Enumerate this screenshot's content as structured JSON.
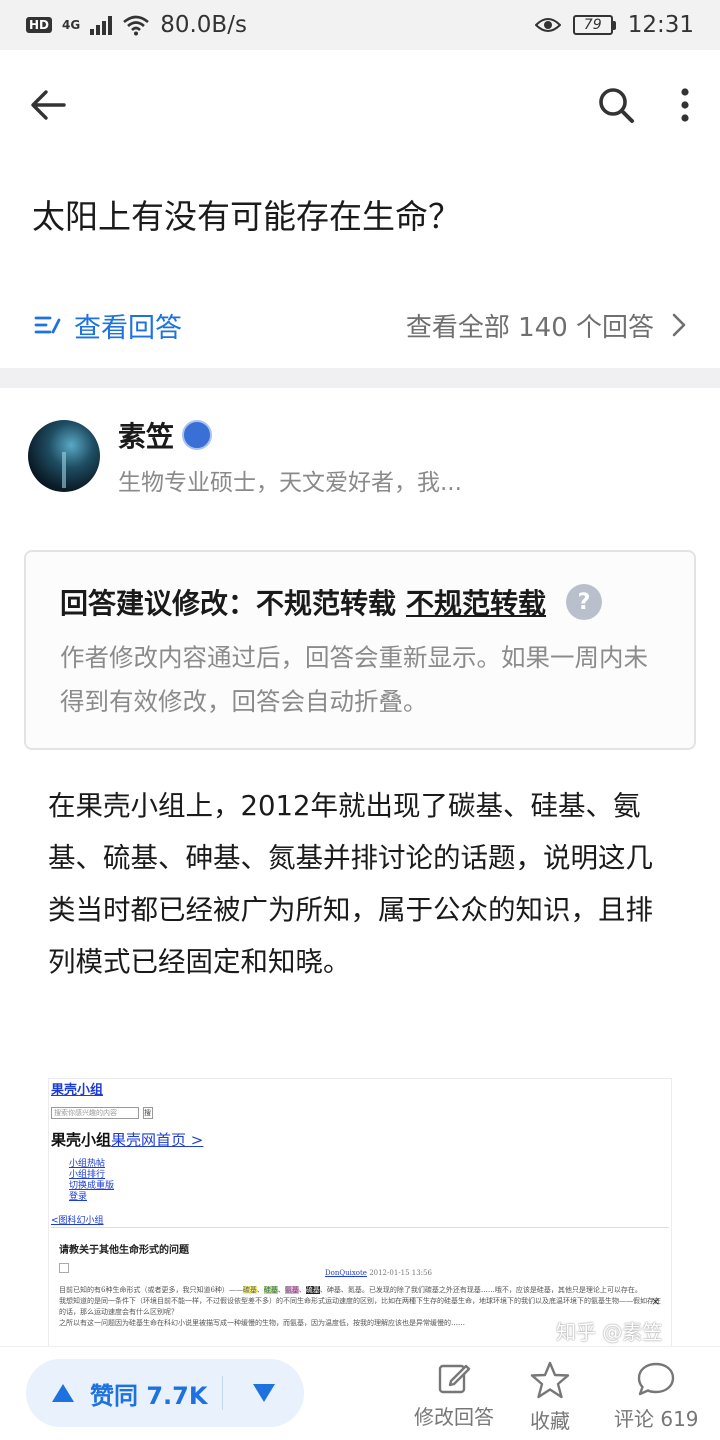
{
  "status_bar": {
    "hd": "HD",
    "network": "4G",
    "speed": "80.0B/s",
    "battery": "79",
    "time": "12:31"
  },
  "top_bar": {
    "back_icon": "arrow-left-icon",
    "search_icon": "search-icon",
    "more_icon": "more-vertical-icon"
  },
  "question": {
    "title": "太阳上有没有可能存在生命？"
  },
  "answer_bar": {
    "view_answers_label": "查看回答",
    "view_all_label": "查看全部 140 个回答"
  },
  "author": {
    "name": "素笠",
    "bio": "生物专业硕士，天文爱好者，我..."
  },
  "notice": {
    "title_prefix": "回答建议修改：不规范转载",
    "title_link": "不规范转载",
    "help": "?",
    "body": "作者修改内容通过后，回答会重新显示。如果一周内未得到有效修改，回答会自动折叠。"
  },
  "answer": {
    "body": "在果壳小组上，2012年就出现了碳基、硅基、氨基、硫基、砷基、氮基并排讨论的话题，说明这几类当时都已经被广为所知，属于公众的知识，且排列模式已经固定和知晓。"
  },
  "embedded": {
    "title": "果壳小组",
    "search_placeholder": "搜索你感兴趣的内容",
    "search_btn": "搜",
    "group_label": "果壳小组",
    "group_link": "果壳网首页 >",
    "links": [
      "小组热帖",
      "小组排行",
      "切换成重版",
      "登录"
    ],
    "back_link": "<图科幻小组",
    "subject": "请教关于其他生命形式的问题",
    "post_author": "DonQuixote",
    "post_time": "2012-01-15 13:56",
    "text_1": "目前已知的有6种生命形式（或者更多，我只知道6种）——",
    "hl_1": "碳基",
    "hl_2": "硅基",
    "hl_3": "氨基",
    "hl_4": "硫基",
    "text_2": "、砷基、氮基。已发现的除了我们碳基之外还有现基……哦不，应该是硅基，其他只是理论上可以存在。",
    "text_3": "我想知道的是同一条件下（环境目前不能一样，不过假设依型差不多）的不同生命形式运动速度的区别，比如在两種下生存的硅基生命，地球环境下的我们以及底温环境下的氨基生物——假如存在的话，那么运动速度会有什么区别呢？",
    "text_4": "之所以有这一问题因为硅基生命在科幻小说里被描写成一种缓慢的生物，而氨基，因为温度低，按我的理解应该也是异常缓慢的……",
    "close": "×"
  },
  "watermark": "知乎 @素笠",
  "bottom_bar": {
    "vote_up_label": "赞同 7.7K",
    "edit_label": "修改回答",
    "fav_label": "收藏",
    "comment_label": "评论 619"
  },
  "colors": {
    "accent": "#1d72e0",
    "vote_bg": "#e9f1fd",
    "muted": "#8a8a8a"
  }
}
